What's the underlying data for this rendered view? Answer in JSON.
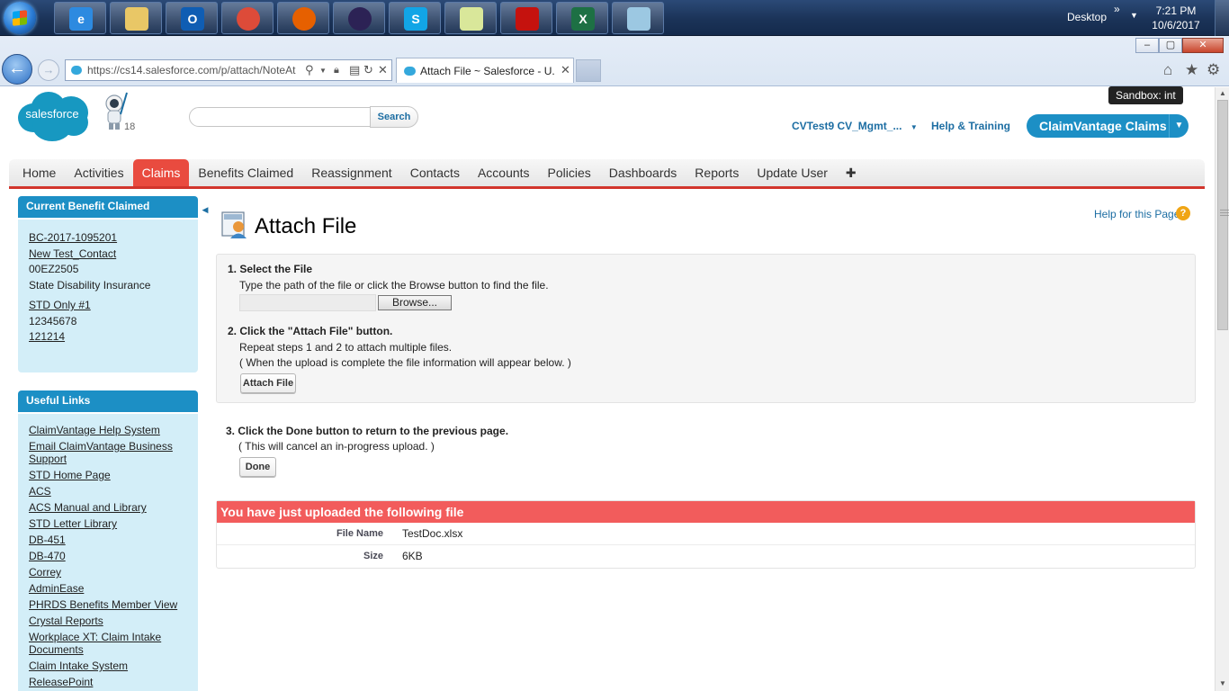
{
  "taskbar": {
    "apps": [
      {
        "name": "internet-explorer-icon",
        "label": "e",
        "color": "#2d8ae0"
      },
      {
        "name": "file-explorer-icon",
        "label": "",
        "color": "#e9c766"
      },
      {
        "name": "outlook-icon",
        "label": "O",
        "color": "#0f5db3"
      },
      {
        "name": "chrome-icon",
        "label": "",
        "color": "#dd4b39"
      },
      {
        "name": "firefox-icon",
        "label": "",
        "color": "#e66000"
      },
      {
        "name": "eclipse-icon",
        "label": "",
        "color": "#2c2255"
      },
      {
        "name": "skype-icon",
        "label": "S",
        "color": "#12a5e6"
      },
      {
        "name": "sticky-notes-icon",
        "label": "",
        "color": "#d9e79a"
      },
      {
        "name": "acrobat-icon",
        "label": "",
        "color": "#c5120e"
      },
      {
        "name": "excel-icon",
        "label": "X",
        "color": "#1d7044"
      },
      {
        "name": "snipping-tool-icon",
        "label": "",
        "color": "#9cc8e2"
      }
    ],
    "desktop_label": "Desktop",
    "chevron": "»",
    "time": "7:21 PM",
    "date": "10/6/2017"
  },
  "browser": {
    "url": "https://cs14.salesforce.com/p/attach/NoteAt",
    "tab_title": "Attach File ~ Salesforce - U...",
    "window_buttons": {
      "minimize": "–",
      "restore": "▢",
      "close": "✕"
    }
  },
  "header": {
    "logo_text": "salesforce",
    "notification_count": "18",
    "search_placeholder": "",
    "search_button": "Search",
    "sandbox_tip": "Sandbox:  int",
    "user_menu": "CVTest9 CV_Mgmt_...",
    "help_training": "Help & Training",
    "app_switcher": "ClaimVantage Claims"
  },
  "nav": {
    "tabs": [
      "Home",
      "Activities",
      "Claims",
      "Benefits Claimed",
      "Reassignment",
      "Contacts",
      "Accounts",
      "Policies",
      "Dashboards",
      "Reports",
      "Update User",
      "✚"
    ],
    "active_index": 2
  },
  "sidebar": {
    "current_title": "Current Benefit Claimed",
    "current_items": [
      {
        "text": "BC-2017-1095201",
        "link": true
      },
      {
        "text": "New Test_Contact",
        "link": true
      },
      {
        "text": "00EZ2505",
        "link": false
      },
      {
        "text": "State Disability Insurance",
        "link": false
      },
      {
        "text": "STD Only #1",
        "link": true
      },
      {
        "text": "12345678",
        "link": false
      },
      {
        "text": "121214",
        "link": true
      }
    ],
    "links_title": "Useful Links",
    "links": [
      "ClaimVantage Help System",
      "Email ClaimVantage Business Support",
      "STD Home Page",
      "ACS",
      "ACS Manual and Library",
      "STD Letter Library",
      "DB-451",
      "DB-470",
      "Correy",
      "AdminEase",
      "PHRDS Benefits Member View",
      "Crystal Reports",
      "Workplace XT: Claim Intake Documents",
      "Claim Intake System",
      "ReleasePoint"
    ]
  },
  "page": {
    "title": "Attach File",
    "help_link": "Help for this Page",
    "help_icon": "?",
    "step1_title": "1.  Select the File",
    "step1_text": "Type the path of the file or click the Browse button to find the file.",
    "browse_button": "Browse...",
    "step2_title": "2.  Click the \"Attach File\" button.",
    "step2_text1": "Repeat steps 1 and 2 to attach multiple files.",
    "step2_text2": "( When the upload is complete the file information will appear below. )",
    "attach_button": "Attach File",
    "step3_title": "3.  Click the Done button to return to the previous page.",
    "step3_text": "( This will cancel an in-progress upload. )",
    "done_button": "Done",
    "upload_header": "You have just uploaded the following file",
    "file_name_label": "File Name",
    "file_name_value": "TestDoc.xlsx",
    "size_label": "Size",
    "size_value": "6KB"
  },
  "colors": {
    "sf_blue": "#1798c1",
    "nav_active": "#e94b3f",
    "sidebar_bg": "#d3eef8",
    "upload_header": "#f25c5c"
  }
}
